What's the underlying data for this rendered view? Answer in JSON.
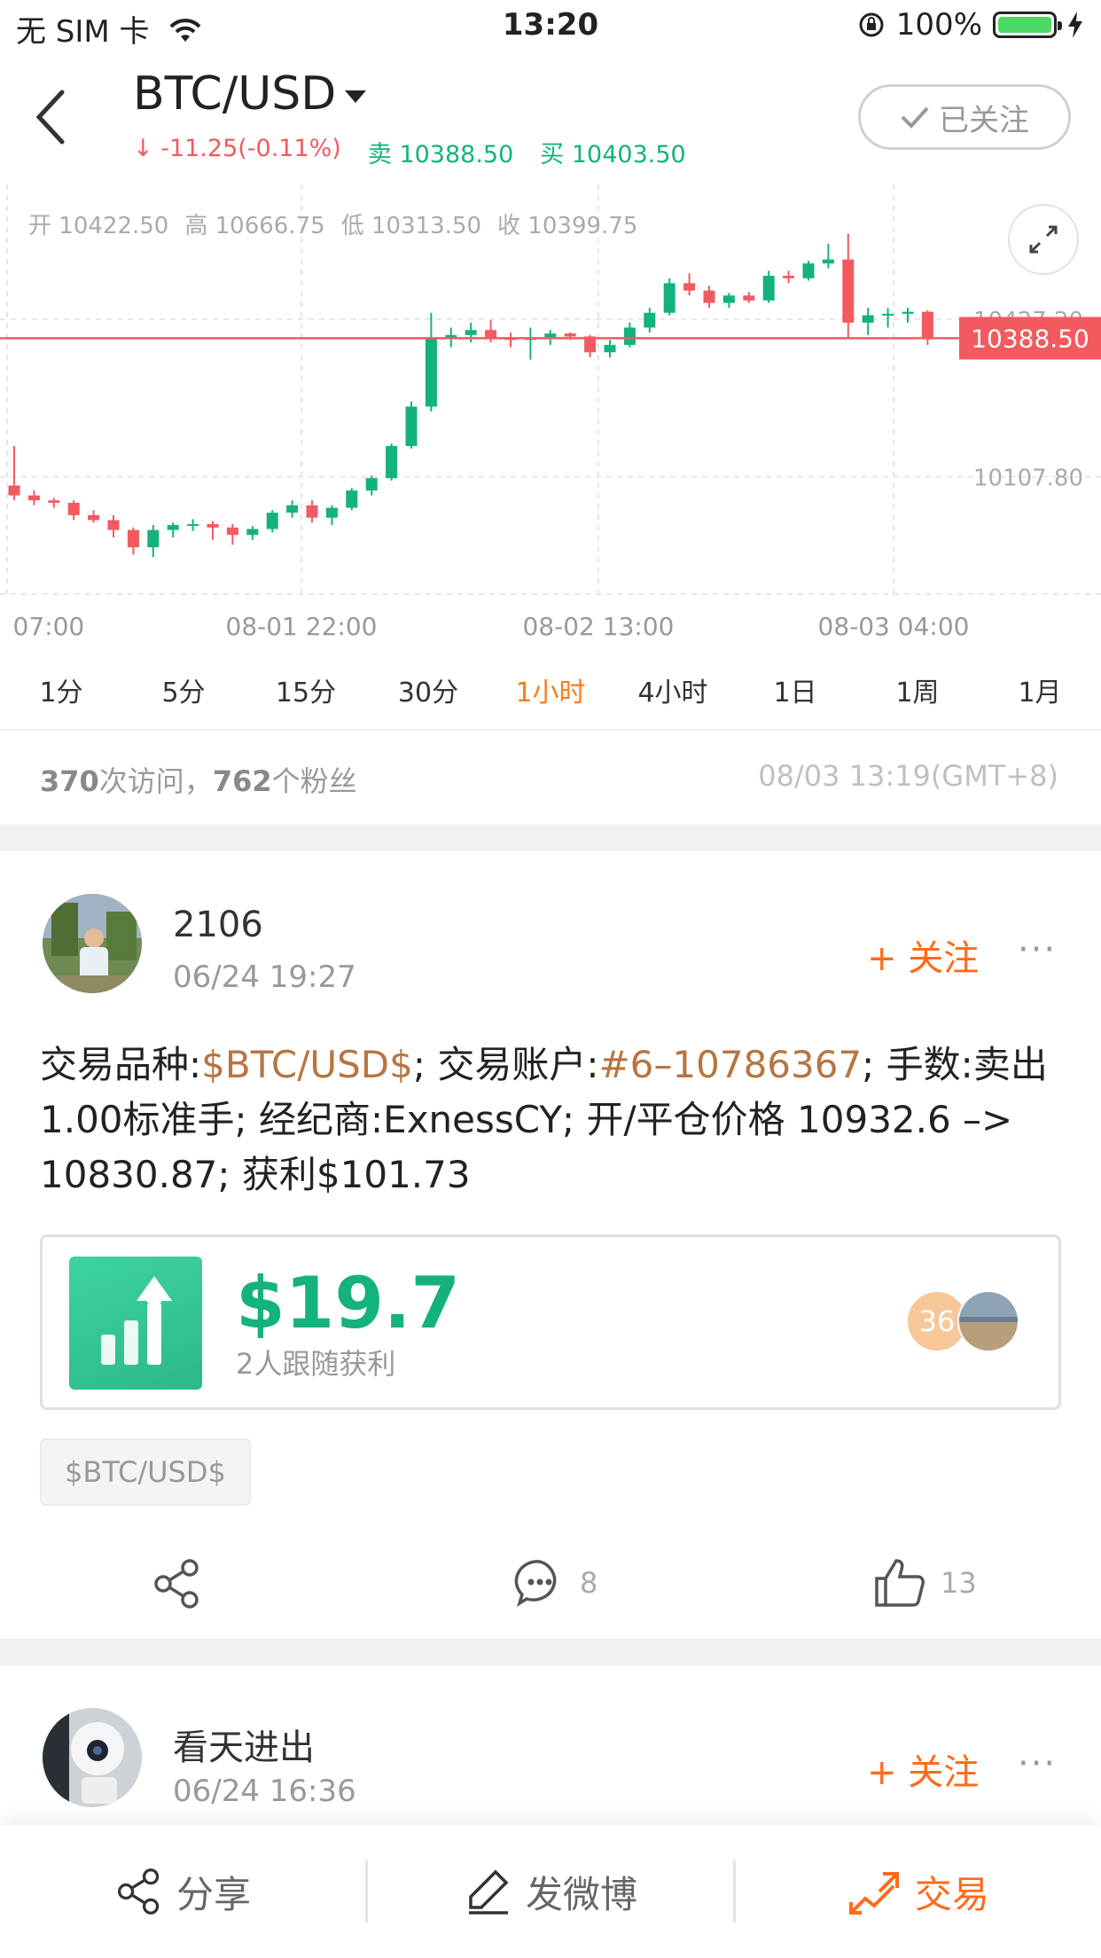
{
  "status_bar": {
    "carrier": "无 SIM 卡",
    "time": "13:20",
    "battery": "100%"
  },
  "header": {
    "pair": "BTC/USD",
    "change": "-11.25(-0.11%)",
    "sell_label": "卖",
    "sell_price": "10388.50",
    "buy_label": "买",
    "buy_price": "10403.50",
    "follow_state": "已关注"
  },
  "ohlc": {
    "open_label": "开",
    "open": "10422.50",
    "high_label": "高",
    "high": "10666.75",
    "low_label": "低",
    "low": "10313.50",
    "close_label": "收",
    "close": "10399.75"
  },
  "chart_data": {
    "type": "candlestick",
    "current_price": 10388.5,
    "y_ticks": [
      10427.2,
      10107.8
    ],
    "x_ticks": [
      "07:00",
      "08-01 22:00",
      "08-02 13:00",
      "08-03 04:00"
    ],
    "candles": [
      {
        "o": 10090,
        "h": 10170,
        "l": 10060,
        "c": 10070
      },
      {
        "o": 10070,
        "h": 10080,
        "l": 10050,
        "c": 10060
      },
      {
        "o": 10060,
        "h": 10065,
        "l": 10045,
        "c": 10055
      },
      {
        "o": 10055,
        "h": 10060,
        "l": 10020,
        "c": 10030
      },
      {
        "o": 10030,
        "h": 10040,
        "l": 10015,
        "c": 10020
      },
      {
        "o": 10020,
        "h": 10030,
        "l": 9985,
        "c": 10000
      },
      {
        "o": 10000,
        "h": 10005,
        "l": 9950,
        "c": 9965
      },
      {
        "o": 9965,
        "h": 10010,
        "l": 9945,
        "c": 10000
      },
      {
        "o": 10000,
        "h": 10015,
        "l": 9985,
        "c": 10010
      },
      {
        "o": 10010,
        "h": 10022,
        "l": 9998,
        "c": 10012
      },
      {
        "o": 10012,
        "h": 10018,
        "l": 9980,
        "c": 10005
      },
      {
        "o": 10005,
        "h": 10012,
        "l": 9970,
        "c": 9990
      },
      {
        "o": 9990,
        "h": 10008,
        "l": 9980,
        "c": 10002
      },
      {
        "o": 10002,
        "h": 10040,
        "l": 9995,
        "c": 10035
      },
      {
        "o": 10035,
        "h": 10060,
        "l": 10025,
        "c": 10050
      },
      {
        "o": 10050,
        "h": 10060,
        "l": 10015,
        "c": 10025
      },
      {
        "o": 10025,
        "h": 10050,
        "l": 10010,
        "c": 10045
      },
      {
        "o": 10045,
        "h": 10085,
        "l": 10040,
        "c": 10080
      },
      {
        "o": 10080,
        "h": 10110,
        "l": 10070,
        "c": 10105
      },
      {
        "o": 10105,
        "h": 10175,
        "l": 10100,
        "c": 10170
      },
      {
        "o": 10170,
        "h": 10260,
        "l": 10165,
        "c": 10250
      },
      {
        "o": 10250,
        "h": 10440,
        "l": 10240,
        "c": 10390
      },
      {
        "o": 10390,
        "h": 10410,
        "l": 10370,
        "c": 10395
      },
      {
        "o": 10395,
        "h": 10420,
        "l": 10380,
        "c": 10405
      },
      {
        "o": 10405,
        "h": 10425,
        "l": 10380,
        "c": 10390
      },
      {
        "o": 10390,
        "h": 10400,
        "l": 10370,
        "c": 10385
      },
      {
        "o": 10385,
        "h": 10410,
        "l": 10345,
        "c": 10390
      },
      {
        "o": 10390,
        "h": 10405,
        "l": 10375,
        "c": 10398
      },
      {
        "o": 10398,
        "h": 10400,
        "l": 10385,
        "c": 10392
      },
      {
        "o": 10392,
        "h": 10395,
        "l": 10350,
        "c": 10360
      },
      {
        "o": 10360,
        "h": 10385,
        "l": 10350,
        "c": 10375
      },
      {
        "o": 10375,
        "h": 10420,
        "l": 10370,
        "c": 10410
      },
      {
        "o": 10410,
        "h": 10450,
        "l": 10400,
        "c": 10440
      },
      {
        "o": 10440,
        "h": 10510,
        "l": 10435,
        "c": 10500
      },
      {
        "o": 10500,
        "h": 10520,
        "l": 10475,
        "c": 10485
      },
      {
        "o": 10485,
        "h": 10495,
        "l": 10450,
        "c": 10460
      },
      {
        "o": 10460,
        "h": 10480,
        "l": 10450,
        "c": 10475
      },
      {
        "o": 10475,
        "h": 10482,
        "l": 10460,
        "c": 10465
      },
      {
        "o": 10465,
        "h": 10525,
        "l": 10460,
        "c": 10515
      },
      {
        "o": 10515,
        "h": 10525,
        "l": 10500,
        "c": 10510
      },
      {
        "o": 10510,
        "h": 10545,
        "l": 10505,
        "c": 10540
      },
      {
        "o": 10540,
        "h": 10580,
        "l": 10530,
        "c": 10548
      },
      {
        "o": 10548,
        "h": 10600,
        "l": 10390,
        "c": 10420
      },
      {
        "o": 10420,
        "h": 10450,
        "l": 10395,
        "c": 10435
      },
      {
        "o": 10435,
        "h": 10450,
        "l": 10410,
        "c": 10438
      },
      {
        "o": 10438,
        "h": 10450,
        "l": 10420,
        "c": 10442
      },
      {
        "o": 10442,
        "h": 10445,
        "l": 10375,
        "c": 10390
      }
    ],
    "up_color": "#14b27c",
    "down_color": "#f25a5f"
  },
  "periods": [
    "1分",
    "5分",
    "15分",
    "30分",
    "1小时",
    "4小时",
    "1日",
    "1周",
    "1月"
  ],
  "active_period": "1小时",
  "stats": {
    "visits": "370",
    "visits_label": "次访问，",
    "fans": "762",
    "fans_label": "个粉丝",
    "timestamp": "08/03 13:19(GMT+8)"
  },
  "posts": [
    {
      "username": "2106",
      "date": "06/24 19:27",
      "follow_label": "+ 关注",
      "more": "···",
      "text_parts": [
        "交易品种:",
        "$BTC/USD$",
        "; 交易账户:",
        "#6–10786367",
        "; 手数:卖出 1.00标准手; 经纪商:ExnessCY; 开/平仓价格 10932.6 –> 10830.87; 获利$101.73"
      ],
      "profit_value": "$19.7",
      "profit_sub": "2人跟随获利",
      "follower_badge": "36",
      "tag": "$BTC/USD$",
      "comments": "8",
      "likes": "13"
    },
    {
      "username": "看天进出",
      "date": "06/24 16:36",
      "follow_label": "+ 关注",
      "more": "···"
    }
  ],
  "bottom_bar": {
    "share": "分享",
    "post": "发微博",
    "trade": "交易"
  },
  "colors": {
    "accent": "#ff6a1a",
    "up": "#14b27c",
    "down": "#f25a5f"
  }
}
